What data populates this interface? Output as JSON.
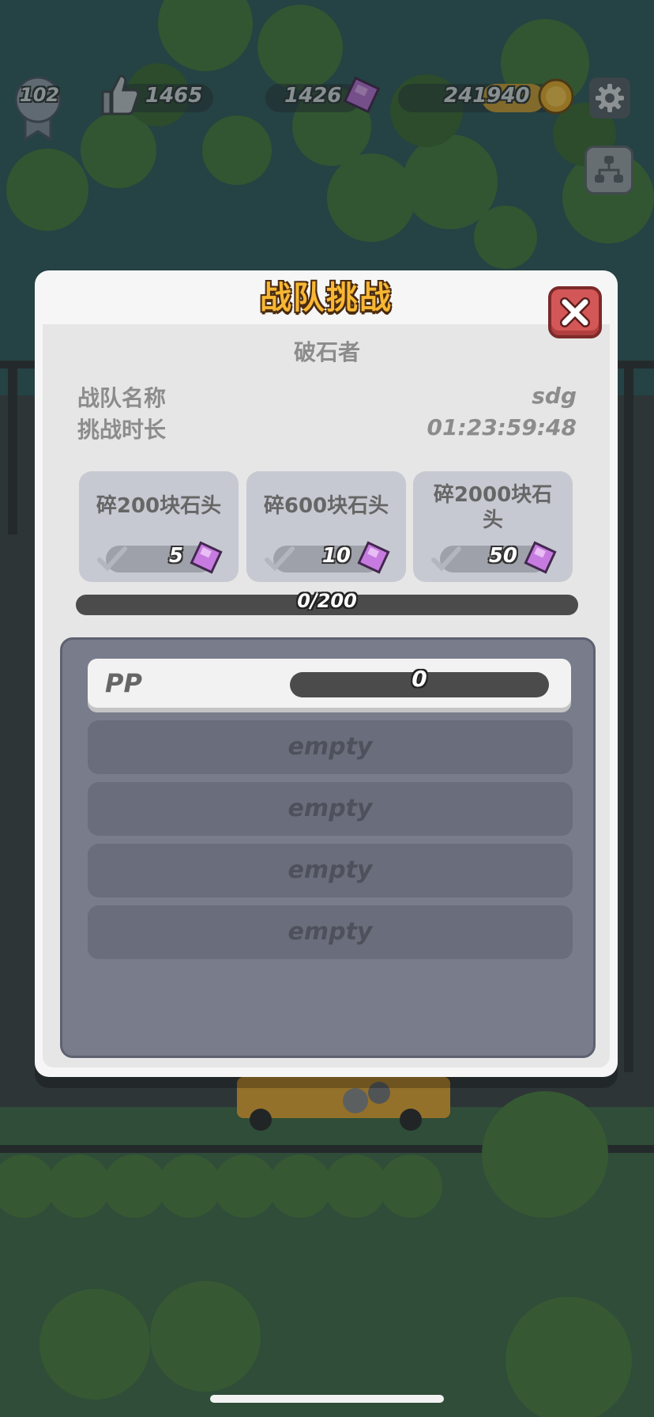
{
  "hud": {
    "level": "102",
    "likes": "1465",
    "gems": "1426",
    "coins": "241940"
  },
  "dialog": {
    "title": "战队挑战",
    "subtitle": "破石者",
    "team_name_label": "战队名称",
    "team_name_value": "sdg",
    "duration_label": "挑战时长",
    "duration_value": "01:23:59:48"
  },
  "milestones": [
    {
      "title": "碎200块石头",
      "reward": "5"
    },
    {
      "title": "碎600块石头",
      "reward": "10"
    },
    {
      "title": "碎2000块石头",
      "reward": "50"
    }
  ],
  "total_progress": {
    "text": "0/200",
    "fraction": 0
  },
  "members": {
    "active": {
      "name": "PP",
      "score": "0"
    },
    "empty_slots": [
      "empty",
      "empty",
      "empty",
      "empty"
    ]
  },
  "colors": {
    "title_gold": "#f7b733",
    "close_red": "#d45757",
    "gem_purple": "#c77be0",
    "coin_gold": "#e0a82a"
  }
}
